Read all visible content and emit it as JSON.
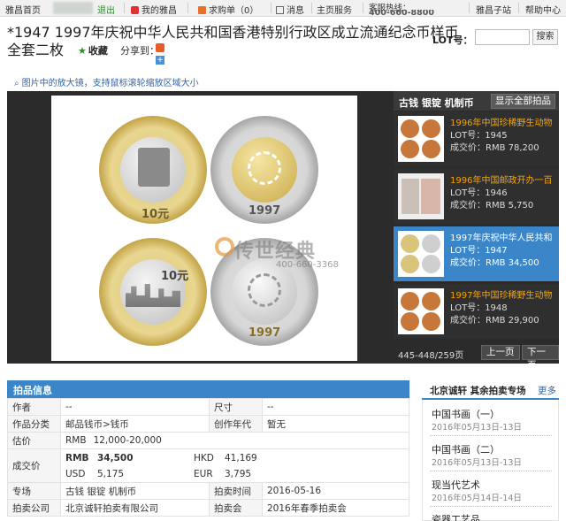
{
  "topbar": {
    "home": "雅昌首页",
    "logout": "退出",
    "my_artron": "我的雅昌",
    "cart": "求购单（0）",
    "messages": "消息",
    "services": "主页服务",
    "hotline_label": "客服热线：",
    "hotline_number": "400-660-8800",
    "sub_site": "雅昌子站",
    "help": "帮助中心"
  },
  "lot": {
    "title": "*1947 1997年庆祝中华人民共和国香港特别行政区成立流通纪念币样币全套二枚",
    "lot_label": "LOT号：",
    "search_button": "搜索",
    "favorite": "收藏",
    "share": "分享到：",
    "hint": "图片中的放大镜，支持鼠标滚轮缩放区域大小"
  },
  "viewer": {
    "coin_denomination": "10元",
    "coin_year": "1997",
    "watermark": "传世经典",
    "watermark_phone": "400-660-3368",
    "category": "古钱 银锭 机制币",
    "show_all": "显示全部拍品",
    "items": [
      {
        "name": "1996年中国珍稀野生动物",
        "lot": "LOT号：1945",
        "price": "成交价：RMB 78,200"
      },
      {
        "name": "1996年中国邮政开办一百",
        "lot": "LOT号：1946",
        "price": "成交价：RMB 5,750"
      },
      {
        "name": "1997年庆祝中华人民共和",
        "lot": "LOT号：1947",
        "price": "成交价：RMB 34,500"
      },
      {
        "name": "1997年中国珍稀野生动物",
        "lot": "LOT号：1948",
        "price": "成交价：RMB 29,900"
      }
    ],
    "paging": "445-448/259页",
    "prev": "上一页",
    "next": "下一页"
  },
  "info": {
    "header": "拍品信息",
    "author_k": "作者",
    "author_v": "--",
    "size_k": "尺寸",
    "size_v": "--",
    "category_k": "作品分类",
    "category_v": "邮品钱币>钱币",
    "era_k": "创作年代",
    "era_v": "暂无",
    "estimate_k": "估价",
    "estimate_cur": "RMB",
    "estimate_v": "12,000-20,000",
    "deal_k": "成交价",
    "rmb_cur": "RMB",
    "rmb_v": "34,500",
    "hkd_cur": "HKD",
    "hkd_v": "41,169",
    "usd_cur": "USD",
    "usd_v": "5,175",
    "eur_cur": "EUR",
    "eur_v": "3,795",
    "session_k": "专场",
    "session_v": "古钱 银锭 机制币",
    "time_k": "拍卖时间",
    "time_v": "2016-05-16",
    "company_k": "拍卖公司",
    "company_v": "北京诚轩拍卖有限公司",
    "auction_k": "拍卖会",
    "auction_v": "2016年春季拍卖会"
  },
  "other_sessions": {
    "title": "北京诚轩 其余拍卖专场",
    "more": "更多",
    "items": [
      {
        "name": "中国书画（一）",
        "date": "2016年05月13日-13日"
      },
      {
        "name": "中国书画（二）",
        "date": "2016年05月13日-13日"
      },
      {
        "name": "现当代艺术",
        "date": "2016年05月14日-14日"
      },
      {
        "name": "瓷器工艺品",
        "date": ""
      }
    ]
  }
}
